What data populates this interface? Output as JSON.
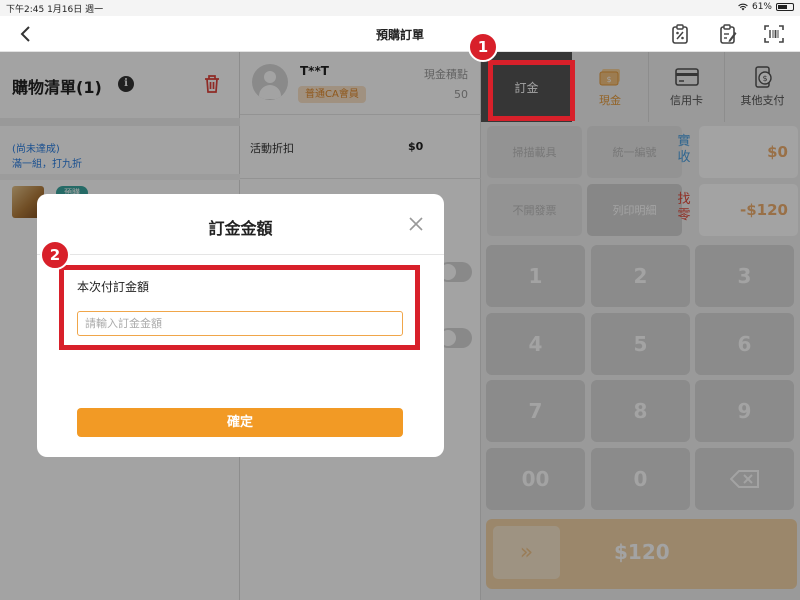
{
  "status_bar": {
    "time_date": "下午2:45   1月16日 週一",
    "battery": "61%"
  },
  "header": {
    "title": "預購訂單"
  },
  "cart": {
    "title": "購物清單(1)",
    "promo_status": "(尚未達成)",
    "promo_detail": "滿一組，打九折",
    "item_tag": "預購"
  },
  "member": {
    "name": "T**T",
    "badge": "普通CA會員",
    "points_label": "現金積點",
    "points_value": "50"
  },
  "discount": {
    "label": "活動折扣",
    "value": "$0"
  },
  "payment_tabs": [
    {
      "label": "訂金"
    },
    {
      "label": "現金"
    },
    {
      "label": "信用卡"
    },
    {
      "label": "其他支付"
    }
  ],
  "function_buttons": [
    {
      "label": "掃描載具"
    },
    {
      "label": "統一編號"
    },
    {
      "label": "不開發票"
    },
    {
      "label": "列印明細"
    }
  ],
  "paid": {
    "label": "實收",
    "value": "$0"
  },
  "change": {
    "label": "找零",
    "value": "-$120"
  },
  "keypad": [
    "1",
    "2",
    "3",
    "4",
    "5",
    "6",
    "7",
    "8",
    "9",
    "00",
    "0"
  ],
  "pay": {
    "arrow": "»",
    "amount": "$120"
  },
  "modal": {
    "title": "訂金金額",
    "field_label": "本次付訂金額",
    "placeholder": "請輸入訂金金額",
    "confirm": "確定"
  },
  "annotations": [
    {
      "number": "1"
    },
    {
      "number": "2"
    }
  ],
  "colors": {
    "highlight": "#d8202a",
    "accent_orange": "#f29a25",
    "cash_accent": "#e69b3c",
    "deposit_tab": "#555555"
  }
}
